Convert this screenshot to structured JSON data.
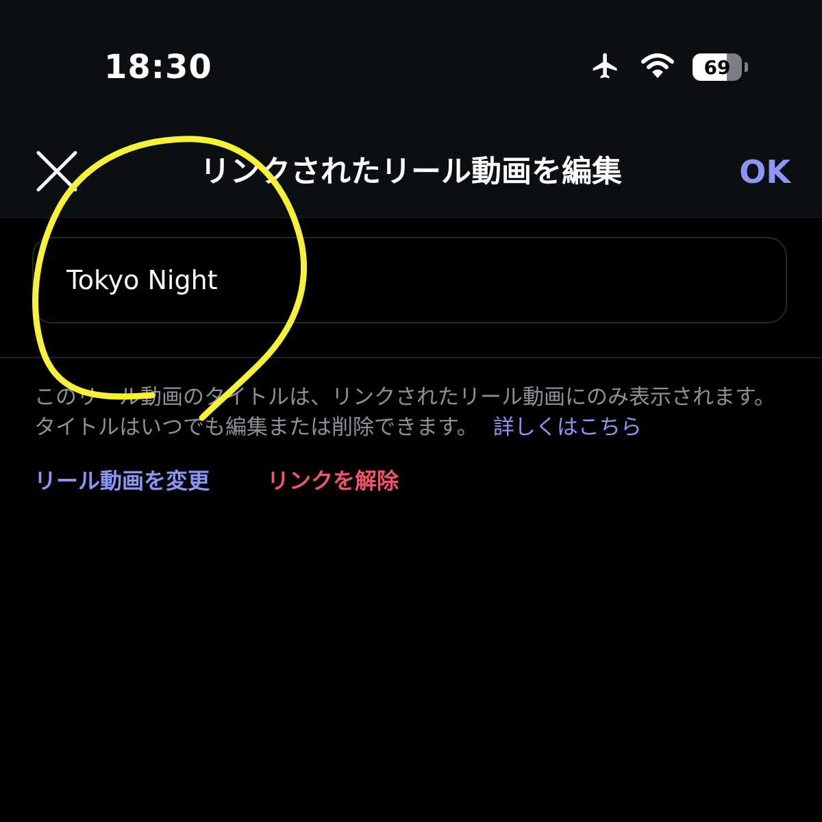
{
  "status_bar": {
    "time": "18:30",
    "battery_level": "69",
    "battery_fraction": 0.69,
    "icons": [
      "airplane-icon",
      "wifi-icon",
      "battery-icon"
    ]
  },
  "nav": {
    "title": "リンクされたリール動画を編集",
    "ok_label": "OK",
    "close_icon": "close-icon"
  },
  "title_field": {
    "value": "Tokyo Night"
  },
  "help": {
    "text": "このリール動画のタイトルは、リンクされたリール動画にのみ表示されます。タイトルはいつでも編集または削除できます。",
    "link": "詳しくはこちら"
  },
  "actions": {
    "change_label": "リール動画を変更",
    "unlink_label": "リンクを解除"
  },
  "colors": {
    "accent": "#8b96f5",
    "destructive": "#f0556a",
    "annotation": "#f7f13a"
  }
}
